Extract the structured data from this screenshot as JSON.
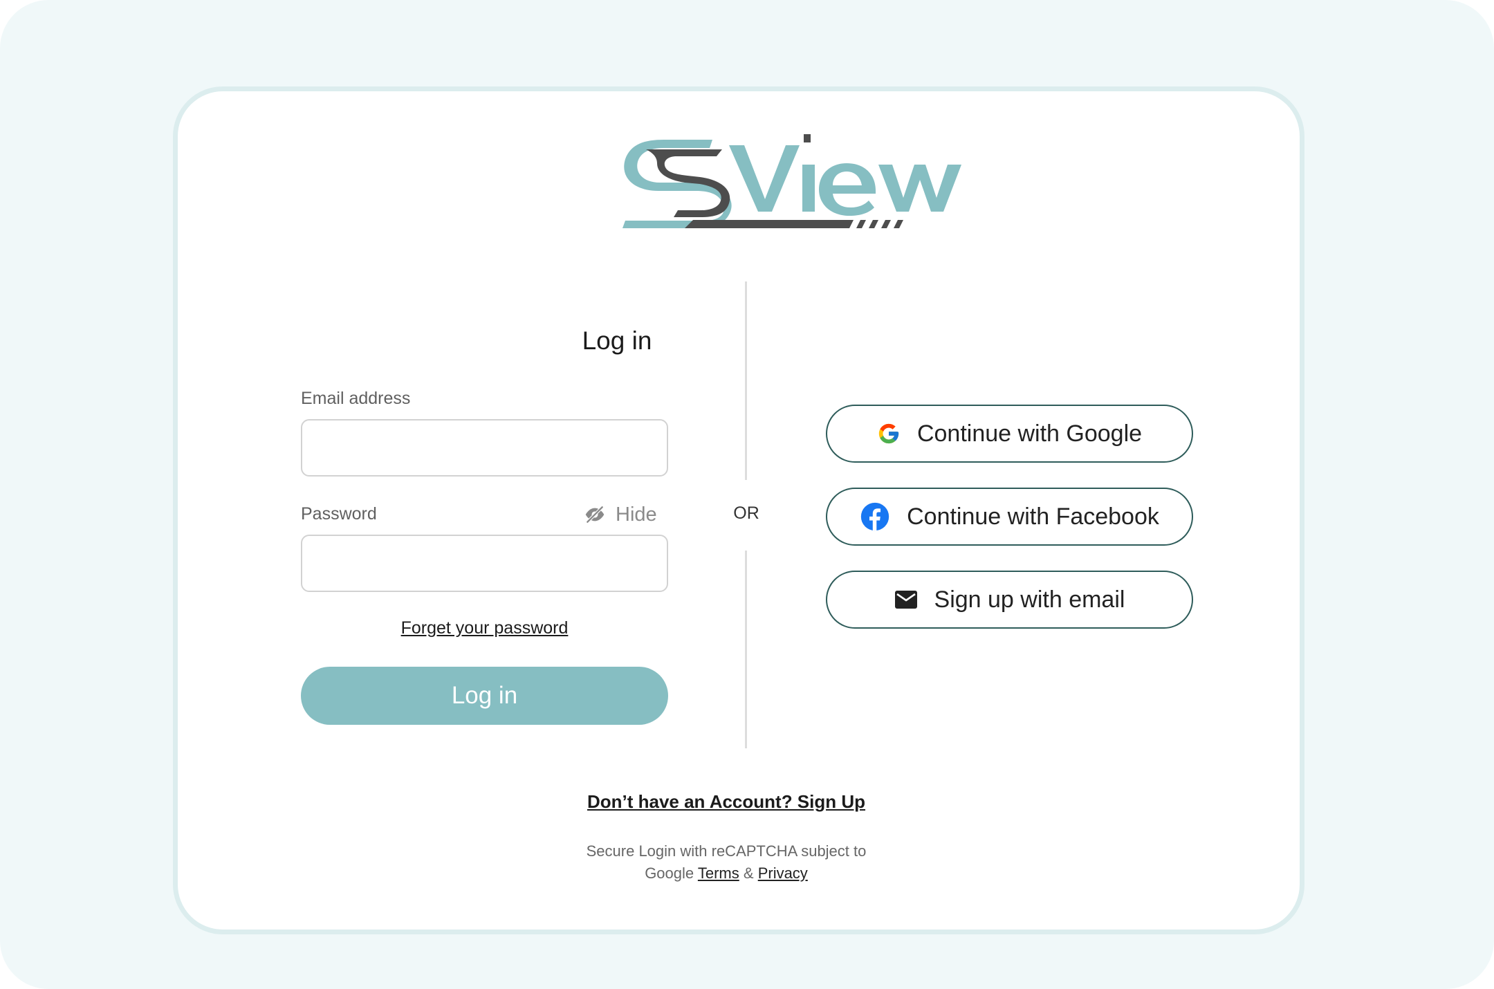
{
  "brand": {
    "logo_text": "SView",
    "colors": {
      "teal": "#86bec2",
      "dark": "#4d4d4d",
      "page_bg": "#f0f8f9",
      "button_border": "#2e5c5a"
    }
  },
  "login": {
    "title": "Log in",
    "email_label": "Email address",
    "email_value": "",
    "password_label": "Password",
    "password_value": "",
    "hide_label": "Hide",
    "hide_icon": "eye-slash-icon",
    "forgot_label": "Forget your password",
    "submit_label": "Log in"
  },
  "divider": {
    "label": "OR"
  },
  "social": {
    "google_label": "Continue with Google",
    "google_icon": "google-icon",
    "facebook_label": "Continue with Facebook",
    "facebook_icon": "facebook-icon",
    "email_label": "Sign up with email",
    "email_icon": "envelope-icon"
  },
  "footer": {
    "signup_label": "Don’t have an Account? Sign Up",
    "recaptcha_line1": "Secure Login with reCAPTCHA subject to",
    "recaptcha_google": "Google",
    "terms_label": "Terms",
    "ampersand": "&",
    "privacy_label": "Privacy"
  }
}
